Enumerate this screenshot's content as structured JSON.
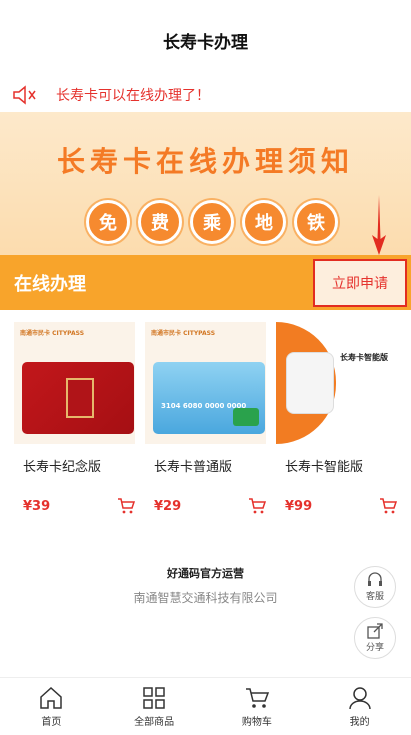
{
  "header": {
    "title": "长寿卡办理"
  },
  "notice": {
    "text": "长寿卡可以在线办理了！"
  },
  "banner": {
    "headline": "长寿卡在线办理须知",
    "circles": [
      "免",
      "费",
      "乘",
      "地",
      "铁"
    ]
  },
  "section": {
    "label": "在线办理",
    "apply_label": "立即申请"
  },
  "products": [
    {
      "name": "长寿卡纪念版",
      "price": "¥39",
      "brand": "南通市民卡 CITYPASS"
    },
    {
      "name": "长寿卡普通版",
      "price": "¥29",
      "brand": "南通市民卡 CITYPASS",
      "card_number": "3104 6080 0000 0000"
    },
    {
      "name": "长寿卡智能版",
      "price": "¥99",
      "tag": "长寿卡智能版"
    }
  ],
  "operator": {
    "line1": "好通码官方运营",
    "line2": "南通智慧交通科技有限公司"
  },
  "float": {
    "service_label": "客服",
    "share_label": "分享"
  },
  "tabbar": [
    {
      "label": "首页",
      "icon": "home-icon"
    },
    {
      "label": "全部商品",
      "icon": "grid-icon"
    },
    {
      "label": "购物车",
      "icon": "cart-icon"
    },
    {
      "label": "我的",
      "icon": "user-icon"
    }
  ],
  "colors": {
    "accent": "#e5322d",
    "orange_bar": "#f8a42b",
    "banner_text": "#f47a25"
  }
}
